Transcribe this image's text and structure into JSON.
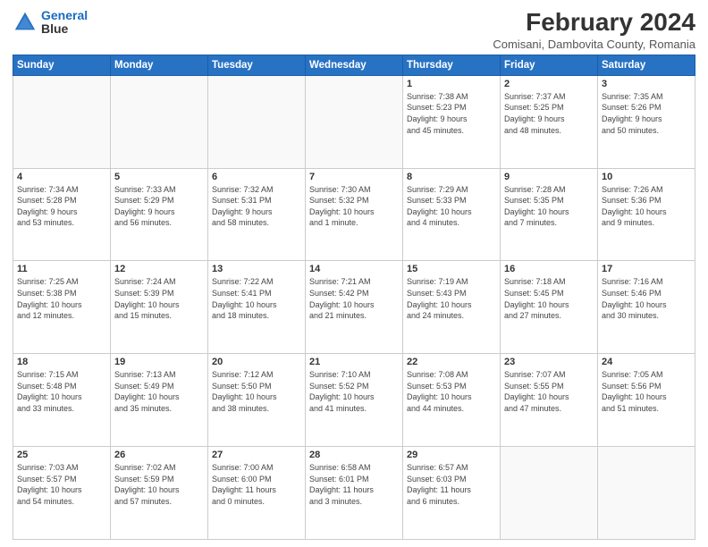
{
  "header": {
    "logo_line1": "General",
    "logo_line2": "Blue",
    "main_title": "February 2024",
    "subtitle": "Comisani, Dambovita County, Romania"
  },
  "weekdays": [
    "Sunday",
    "Monday",
    "Tuesday",
    "Wednesday",
    "Thursday",
    "Friday",
    "Saturday"
  ],
  "weeks": [
    [
      {
        "day": "",
        "info": ""
      },
      {
        "day": "",
        "info": ""
      },
      {
        "day": "",
        "info": ""
      },
      {
        "day": "",
        "info": ""
      },
      {
        "day": "1",
        "info": "Sunrise: 7:38 AM\nSunset: 5:23 PM\nDaylight: 9 hours\nand 45 minutes."
      },
      {
        "day": "2",
        "info": "Sunrise: 7:37 AM\nSunset: 5:25 PM\nDaylight: 9 hours\nand 48 minutes."
      },
      {
        "day": "3",
        "info": "Sunrise: 7:35 AM\nSunset: 5:26 PM\nDaylight: 9 hours\nand 50 minutes."
      }
    ],
    [
      {
        "day": "4",
        "info": "Sunrise: 7:34 AM\nSunset: 5:28 PM\nDaylight: 9 hours\nand 53 minutes."
      },
      {
        "day": "5",
        "info": "Sunrise: 7:33 AM\nSunset: 5:29 PM\nDaylight: 9 hours\nand 56 minutes."
      },
      {
        "day": "6",
        "info": "Sunrise: 7:32 AM\nSunset: 5:31 PM\nDaylight: 9 hours\nand 58 minutes."
      },
      {
        "day": "7",
        "info": "Sunrise: 7:30 AM\nSunset: 5:32 PM\nDaylight: 10 hours\nand 1 minute."
      },
      {
        "day": "8",
        "info": "Sunrise: 7:29 AM\nSunset: 5:33 PM\nDaylight: 10 hours\nand 4 minutes."
      },
      {
        "day": "9",
        "info": "Sunrise: 7:28 AM\nSunset: 5:35 PM\nDaylight: 10 hours\nand 7 minutes."
      },
      {
        "day": "10",
        "info": "Sunrise: 7:26 AM\nSunset: 5:36 PM\nDaylight: 10 hours\nand 9 minutes."
      }
    ],
    [
      {
        "day": "11",
        "info": "Sunrise: 7:25 AM\nSunset: 5:38 PM\nDaylight: 10 hours\nand 12 minutes."
      },
      {
        "day": "12",
        "info": "Sunrise: 7:24 AM\nSunset: 5:39 PM\nDaylight: 10 hours\nand 15 minutes."
      },
      {
        "day": "13",
        "info": "Sunrise: 7:22 AM\nSunset: 5:41 PM\nDaylight: 10 hours\nand 18 minutes."
      },
      {
        "day": "14",
        "info": "Sunrise: 7:21 AM\nSunset: 5:42 PM\nDaylight: 10 hours\nand 21 minutes."
      },
      {
        "day": "15",
        "info": "Sunrise: 7:19 AM\nSunset: 5:43 PM\nDaylight: 10 hours\nand 24 minutes."
      },
      {
        "day": "16",
        "info": "Sunrise: 7:18 AM\nSunset: 5:45 PM\nDaylight: 10 hours\nand 27 minutes."
      },
      {
        "day": "17",
        "info": "Sunrise: 7:16 AM\nSunset: 5:46 PM\nDaylight: 10 hours\nand 30 minutes."
      }
    ],
    [
      {
        "day": "18",
        "info": "Sunrise: 7:15 AM\nSunset: 5:48 PM\nDaylight: 10 hours\nand 33 minutes."
      },
      {
        "day": "19",
        "info": "Sunrise: 7:13 AM\nSunset: 5:49 PM\nDaylight: 10 hours\nand 35 minutes."
      },
      {
        "day": "20",
        "info": "Sunrise: 7:12 AM\nSunset: 5:50 PM\nDaylight: 10 hours\nand 38 minutes."
      },
      {
        "day": "21",
        "info": "Sunrise: 7:10 AM\nSunset: 5:52 PM\nDaylight: 10 hours\nand 41 minutes."
      },
      {
        "day": "22",
        "info": "Sunrise: 7:08 AM\nSunset: 5:53 PM\nDaylight: 10 hours\nand 44 minutes."
      },
      {
        "day": "23",
        "info": "Sunrise: 7:07 AM\nSunset: 5:55 PM\nDaylight: 10 hours\nand 47 minutes."
      },
      {
        "day": "24",
        "info": "Sunrise: 7:05 AM\nSunset: 5:56 PM\nDaylight: 10 hours\nand 51 minutes."
      }
    ],
    [
      {
        "day": "25",
        "info": "Sunrise: 7:03 AM\nSunset: 5:57 PM\nDaylight: 10 hours\nand 54 minutes."
      },
      {
        "day": "26",
        "info": "Sunrise: 7:02 AM\nSunset: 5:59 PM\nDaylight: 10 hours\nand 57 minutes."
      },
      {
        "day": "27",
        "info": "Sunrise: 7:00 AM\nSunset: 6:00 PM\nDaylight: 11 hours\nand 0 minutes."
      },
      {
        "day": "28",
        "info": "Sunrise: 6:58 AM\nSunset: 6:01 PM\nDaylight: 11 hours\nand 3 minutes."
      },
      {
        "day": "29",
        "info": "Sunrise: 6:57 AM\nSunset: 6:03 PM\nDaylight: 11 hours\nand 6 minutes."
      },
      {
        "day": "",
        "info": ""
      },
      {
        "day": "",
        "info": ""
      }
    ]
  ]
}
